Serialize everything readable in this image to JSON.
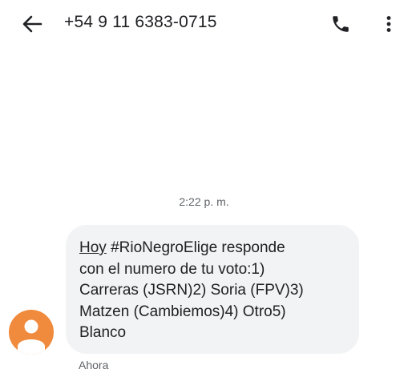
{
  "header": {
    "contact_number": "+54 9 11 6383-0715",
    "back_icon": "arrow-left-icon",
    "call_icon": "phone-icon",
    "menu_icon": "more-vert-icon"
  },
  "conversation": {
    "timestamp": "2:22 p. m.",
    "message": {
      "prefix": "Hoy",
      "body": " #RioNegroElige responde\ncon el numero de tu voto:1)\nCarreras (JSRN)2) Soria (FPV)3)\nMatzen (Cambiemos)4) Otro5)\nBlanco",
      "status": "Ahora"
    },
    "sender_avatar_icon": "person-icon",
    "avatar_color": "#f08a3c"
  }
}
